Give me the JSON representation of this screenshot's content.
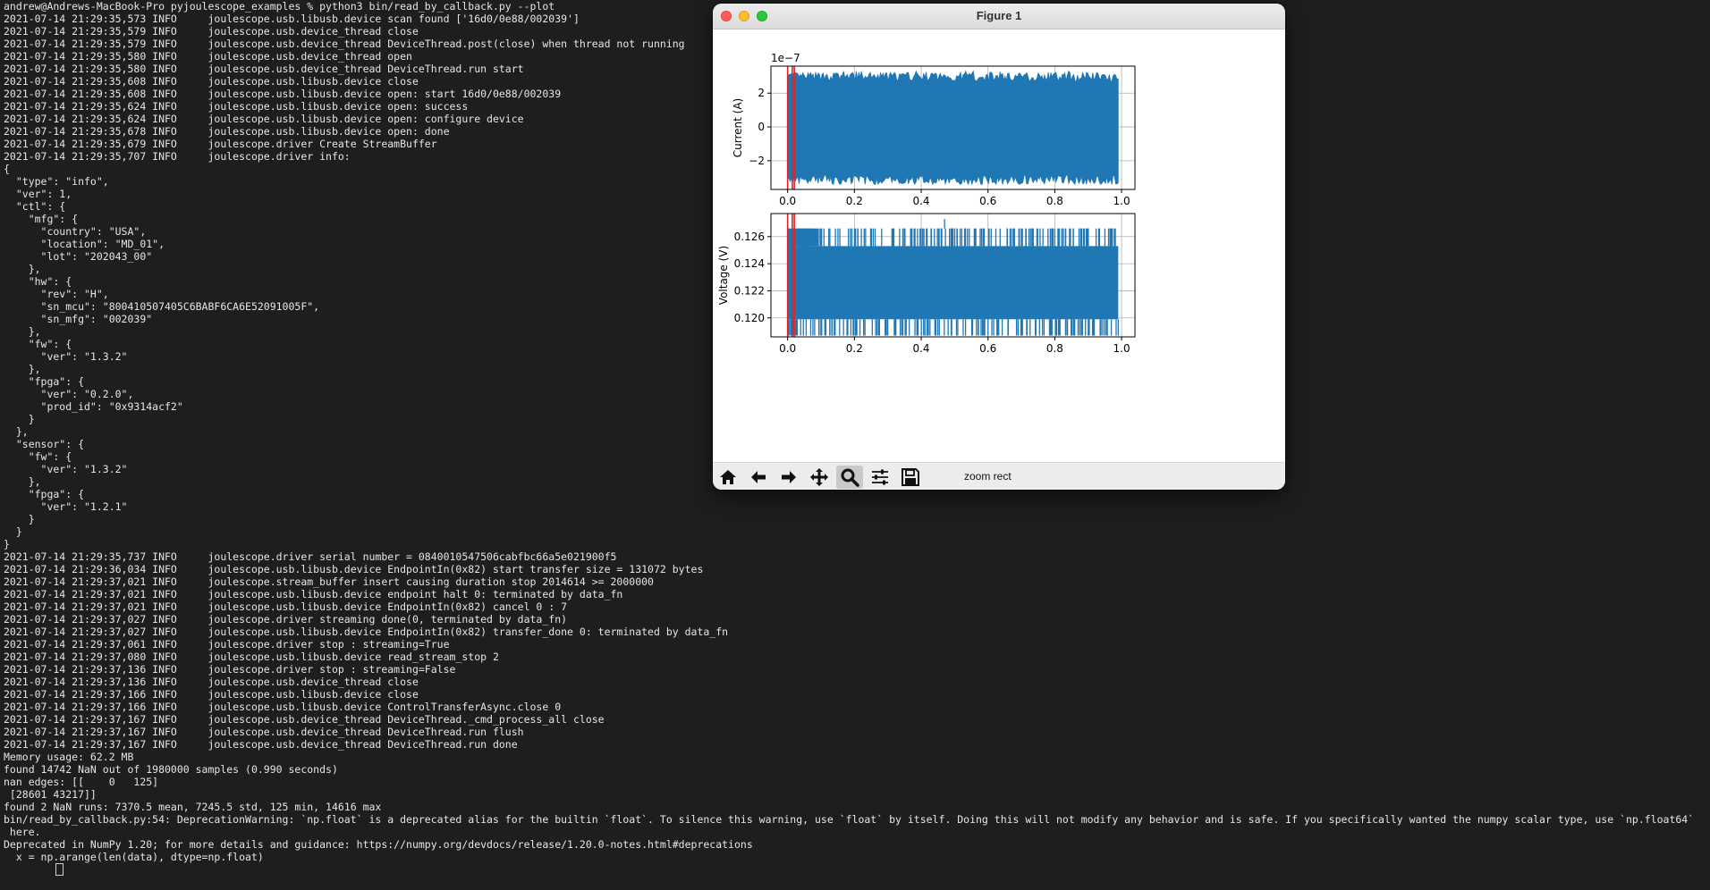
{
  "terminal": {
    "lines": [
      "andrew@Andrews-MacBook-Pro pyjoulescope_examples % python3 bin/read_by_callback.py --plot",
      "2021-07-14 21:29:35,573 INFO     joulescope.usb.libusb.device scan found ['16d0/0e88/002039']",
      "2021-07-14 21:29:35,579 INFO     joulescope.usb.device_thread close",
      "2021-07-14 21:29:35,579 INFO     joulescope.usb.device_thread DeviceThread.post(close) when thread not running",
      "2021-07-14 21:29:35,580 INFO     joulescope.usb.device_thread open",
      "2021-07-14 21:29:35,580 INFO     joulescope.usb.device_thread DeviceThread.run start",
      "2021-07-14 21:29:35,608 INFO     joulescope.usb.libusb.device close",
      "2021-07-14 21:29:35,608 INFO     joulescope.usb.libusb.device open: start 16d0/0e88/002039",
      "2021-07-14 21:29:35,624 INFO     joulescope.usb.libusb.device open: success",
      "2021-07-14 21:29:35,624 INFO     joulescope.usb.libusb.device open: configure device",
      "2021-07-14 21:29:35,678 INFO     joulescope.usb.libusb.device open: done",
      "2021-07-14 21:29:35,679 INFO     joulescope.driver Create StreamBuffer",
      "2021-07-14 21:29:35,707 INFO     joulescope.driver info:",
      "{",
      "  \"type\": \"info\",",
      "  \"ver\": 1,",
      "  \"ctl\": {",
      "    \"mfg\": {",
      "      \"country\": \"USA\",",
      "      \"location\": \"MD_01\",",
      "      \"lot\": \"202043_00\"",
      "    },",
      "    \"hw\": {",
      "      \"rev\": \"H\",",
      "      \"sn_mcu\": \"800410507405C6BABF6CA6E52091005F\",",
      "      \"sn_mfg\": \"002039\"",
      "    },",
      "    \"fw\": {",
      "      \"ver\": \"1.3.2\"",
      "    },",
      "    \"fpga\": {",
      "      \"ver\": \"0.2.0\",",
      "      \"prod_id\": \"0x9314acf2\"",
      "    }",
      "  },",
      "  \"sensor\": {",
      "    \"fw\": {",
      "      \"ver\": \"1.3.2\"",
      "    },",
      "    \"fpga\": {",
      "      \"ver\": \"1.2.1\"",
      "    }",
      "  }",
      "}",
      "2021-07-14 21:29:35,737 INFO     joulescope.driver serial number = 0840010547506cabfbc66a5e021900f5",
      "2021-07-14 21:29:36,034 INFO     joulescope.usb.libusb.device EndpointIn(0x82) start transfer size = 131072 bytes",
      "2021-07-14 21:29:37,021 INFO     joulescope.stream_buffer insert causing duration stop 2014614 >= 2000000",
      "2021-07-14 21:29:37,021 INFO     joulescope.usb.libusb.device endpoint halt 0: terminated by data_fn",
      "2021-07-14 21:29:37,021 INFO     joulescope.usb.libusb.device EndpointIn(0x82) cancel 0 : 7",
      "2021-07-14 21:29:37,027 INFO     joulescope.driver streaming done(0, terminated by data_fn)",
      "2021-07-14 21:29:37,027 INFO     joulescope.usb.libusb.device EndpointIn(0x82) transfer_done 0: terminated by data_fn",
      "2021-07-14 21:29:37,061 INFO     joulescope.driver stop : streaming=True",
      "2021-07-14 21:29:37,080 INFO     joulescope.usb.libusb.device read_stream_stop 2",
      "2021-07-14 21:29:37,136 INFO     joulescope.driver stop : streaming=False",
      "2021-07-14 21:29:37,136 INFO     joulescope.usb.device_thread close",
      "2021-07-14 21:29:37,166 INFO     joulescope.usb.libusb.device close",
      "2021-07-14 21:29:37,166 INFO     joulescope.usb.libusb.device ControlTransferAsync.close 0",
      "2021-07-14 21:29:37,167 INFO     joulescope.usb.device_thread DeviceThread._cmd_process_all close",
      "2021-07-14 21:29:37,167 INFO     joulescope.usb.device_thread DeviceThread.run flush",
      "2021-07-14 21:29:37,167 INFO     joulescope.usb.device_thread DeviceThread.run done",
      "Memory usage: 62.2 MB",
      "found 14742 NaN out of 1980000 samples (0.990 seconds)",
      "nan edges: [[    0   125]",
      " [28601 43217]]",
      "found 2 NaN runs: 7370.5 mean, 7245.5 std, 125 min, 14616 max",
      "bin/read_by_callback.py:54: DeprecationWarning: `np.float` is a deprecated alias for the builtin `float`. To silence this warning, use `float` by itself. Doing this will not modify any behavior and is safe. If you specifically wanted the numpy scalar type, use `np.float64`",
      " here.",
      "Deprecated in NumPy 1.20; for more details and guidance: https://numpy.org/devdocs/release/1.20.0-notes.html#deprecations",
      "  x = np.arange(len(data), dtype=np.float)"
    ]
  },
  "window": {
    "title": "Figure 1",
    "toolbar": {
      "status": "zoom rect",
      "tools": [
        "home-icon",
        "back-arrow-icon",
        "forward-arrow-icon",
        "pan-icon",
        "zoom-icon",
        "configure-subplots-icon",
        "save-icon"
      ],
      "active_tool": "zoom-icon"
    }
  },
  "chart_data": [
    {
      "type": "line",
      "title": "",
      "xlabel": "",
      "ylabel": "Current (A)",
      "offset_label": "1e−7",
      "xlim": [
        -0.05,
        1.04
      ],
      "ylim": [
        -3.7,
        3.6
      ],
      "x_ticks": [
        "0.0",
        "0.2",
        "0.4",
        "0.6",
        "0.8",
        "1.0"
      ],
      "y_ticks": [
        "−2",
        "0",
        "2"
      ],
      "y_tick_values": [
        -2,
        0,
        2
      ],
      "grid": true,
      "series": [
        {
          "color": "#1f77b4",
          "x": [
            0.0,
            0.99
          ],
          "y_envelope_max": [
            3.0,
            3.0
          ],
          "y_envelope_min": [
            -3.1,
            -3.1
          ],
          "y_peak_max": 3.3,
          "y_peak_min": -3.4
        }
      ],
      "markers": [
        {
          "x": 0.0,
          "color": "#d62728"
        },
        {
          "x": 0.014,
          "color": "#d62728"
        },
        {
          "x": 0.02,
          "color": "#d62728"
        }
      ]
    },
    {
      "type": "line",
      "title": "",
      "xlabel": "",
      "ylabel": "Voltage (V)",
      "xlim": [
        -0.05,
        1.04
      ],
      "ylim": [
        0.1186,
        0.1277
      ],
      "x_ticks": [
        "0.0",
        "0.2",
        "0.4",
        "0.6",
        "0.8",
        "1.0"
      ],
      "y_ticks": [
        "0.120",
        "0.122",
        "0.124",
        "0.126"
      ],
      "y_tick_values": [
        0.12,
        0.122,
        0.124,
        0.126
      ],
      "grid": true,
      "series": [
        {
          "color": "#1f77b4",
          "x": [
            0.0,
            0.99
          ],
          "y_main_max": 0.1253,
          "y_main_min": 0.1199,
          "y_spike_high": 0.1266,
          "y_spike_low": 0.1187,
          "y_peak": 0.1273
        }
      ],
      "markers": [
        {
          "x": 0.0,
          "color": "#d62728"
        },
        {
          "x": 0.014,
          "color": "#d62728"
        },
        {
          "x": 0.02,
          "color": "#d62728"
        }
      ]
    }
  ]
}
